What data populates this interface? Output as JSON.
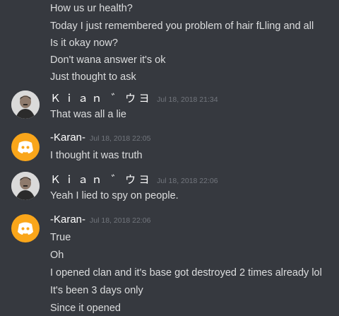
{
  "colors": {
    "background": "#36393f",
    "text": "#dcddde",
    "username": "#ffffff",
    "timestamp": "#72767d",
    "discord_avatar": "#faa61a"
  },
  "intro_lines": [
    "How us ur health?",
    "Today I just remembered you problem of hair fLling and all",
    "Is it okay now?",
    "Don't wana answer it's ok",
    "Just thought to ask"
  ],
  "groups": [
    {
      "avatar_icon": "user-photo-avatar",
      "username": "Ｋｉａｎ  ゛ウヨ",
      "timestamp": "Jul 18, 2018 21:34",
      "lines": [
        "That was all a lie"
      ]
    },
    {
      "avatar_icon": "discord-logo-avatar",
      "username": "-Karan-",
      "timestamp": "Jul 18, 2018 22:05",
      "lines": [
        "I thought it was truth"
      ]
    },
    {
      "avatar_icon": "user-photo-avatar",
      "username": "Ｋｉａｎ  ゛ウヨ",
      "timestamp": "Jul 18, 2018 22:06",
      "lines": [
        "Yeah I lied to spy on people."
      ]
    },
    {
      "avatar_icon": "discord-logo-avatar",
      "username": "-Karan-",
      "timestamp": "Jul 18, 2018 22:06",
      "lines": [
        "True",
        "Oh",
        "I opened clan and it's base got destroyed 2 times already lol",
        "It's been 3 days only",
        "Since it opened"
      ]
    }
  ]
}
